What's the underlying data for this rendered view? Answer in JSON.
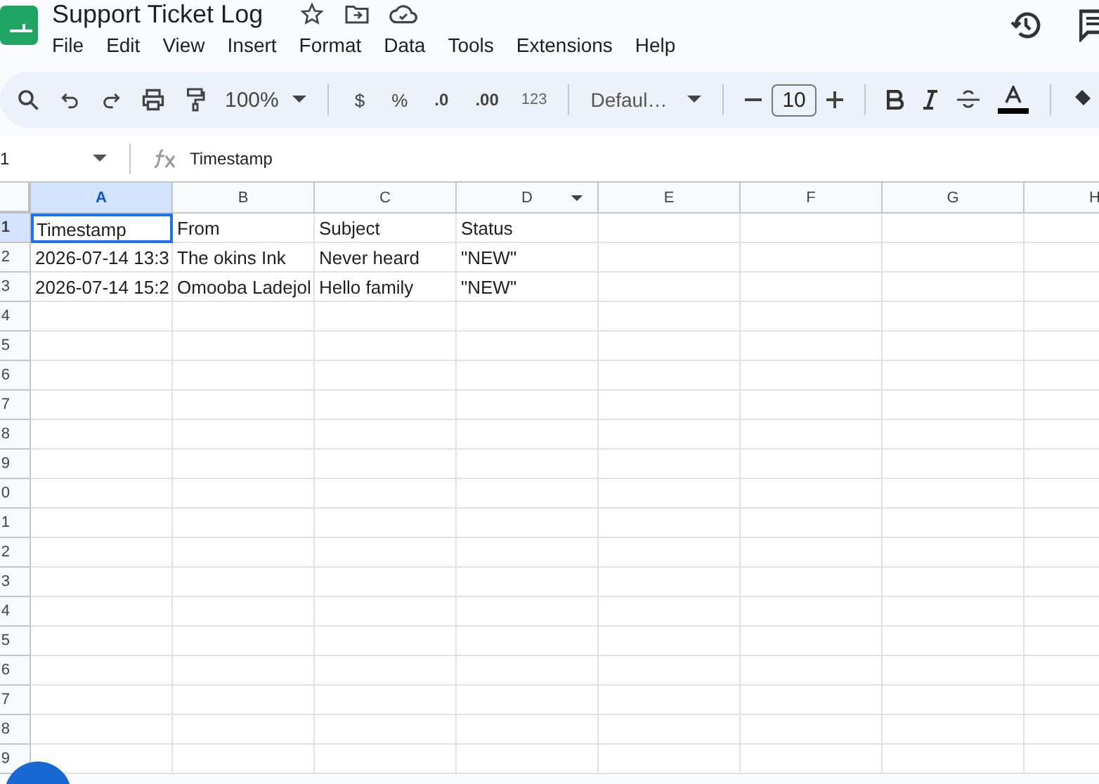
{
  "document": {
    "title": "Support Ticket Log"
  },
  "menu": [
    "File",
    "Edit",
    "View",
    "Insert",
    "Format",
    "Data",
    "Tools",
    "Extensions",
    "Help"
  ],
  "toolbar": {
    "zoom": "100%",
    "currency": "$",
    "percent": "%",
    "decrease_decimals": ".0",
    "increase_decimals": ".00",
    "number_format": "123",
    "font": "Defaul…",
    "font_size": "10"
  },
  "formula_bar": {
    "name_box": "1",
    "formula": "Timestamp"
  },
  "columns": [
    {
      "label": "A",
      "selected": true,
      "filter": false
    },
    {
      "label": "B",
      "selected": false,
      "filter": false
    },
    {
      "label": "C",
      "selected": false,
      "filter": false
    },
    {
      "label": "D",
      "selected": false,
      "filter": true
    },
    {
      "label": "E",
      "selected": false,
      "filter": false
    },
    {
      "label": "F",
      "selected": false,
      "filter": false
    },
    {
      "label": "G",
      "selected": false,
      "filter": false
    },
    {
      "label": "H",
      "selected": false,
      "filter": false
    }
  ],
  "rows": [
    {
      "number": "1",
      "selected": true,
      "cells": [
        {
          "text": "Timestamp",
          "selected": true
        },
        {
          "text": "From",
          "selected": false
        },
        {
          "text": "Subject",
          "selected": false
        },
        {
          "text": "Status",
          "selected": false
        }
      ]
    },
    {
      "number": "2",
      "selected": false,
      "cells": [
        {
          "text": "2026-07-14 13:3",
          "selected": false
        },
        {
          "text": "The okins Ink",
          "selected": false
        },
        {
          "text": "Never heard",
          "selected": false
        },
        {
          "text": "\"NEW\"",
          "selected": false
        }
      ]
    },
    {
      "number": "3",
      "selected": false,
      "cells": [
        {
          "text": "2026-07-14 15:2",
          "selected": false
        },
        {
          "text": "Omooba Ladejol",
          "selected": false
        },
        {
          "text": "Hello family",
          "selected": false
        },
        {
          "text": "\"NEW\"",
          "selected": false
        }
      ]
    },
    {
      "number": "4",
      "selected": false
    },
    {
      "number": "5",
      "selected": false
    },
    {
      "number": "6",
      "selected": false
    },
    {
      "number": "7",
      "selected": false
    },
    {
      "number": "8",
      "selected": false
    },
    {
      "number": "9",
      "selected": false
    },
    {
      "number": "0",
      "selected": false
    },
    {
      "number": "1",
      "selected": false
    },
    {
      "number": "2",
      "selected": false
    },
    {
      "number": "3",
      "selected": false
    },
    {
      "number": "4",
      "selected": false
    },
    {
      "number": "5",
      "selected": false
    },
    {
      "number": "6",
      "selected": false
    },
    {
      "number": "7",
      "selected": false
    },
    {
      "number": "8",
      "selected": false
    },
    {
      "number": "9",
      "selected": false
    }
  ]
}
